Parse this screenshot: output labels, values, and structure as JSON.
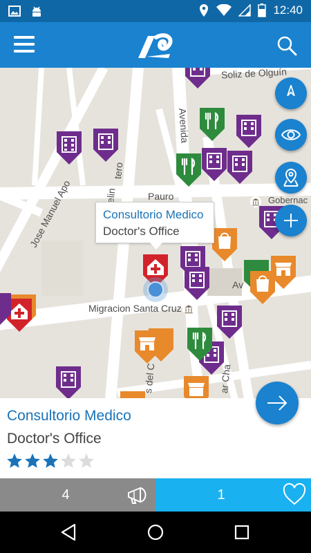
{
  "status_bar": {
    "time": "12:40",
    "left_icons": [
      "image-icon",
      "android-icon"
    ],
    "right_icons": [
      "location-icon",
      "wifi-icon",
      "signal-icon",
      "battery-icon"
    ]
  },
  "app_bar": {
    "menu_icon": "hamburger-icon",
    "logo": "app-logo",
    "search_icon": "search-icon"
  },
  "map": {
    "streets": [
      "Soliz de Olguín",
      "Avenida",
      "Jose Manuel Apo",
      "Marcelin",
      "tero",
      "Pauro",
      "Migracion Santa Cruz",
      "Gobernac",
      "Av",
      "s del C",
      "ar Cha"
    ],
    "buttons": [
      "compass-icon",
      "eye-icon",
      "map-pin-icon",
      "plus-icon"
    ]
  },
  "callout": {
    "title": "Consultorio Medico",
    "subtitle": "Doctor's Office"
  },
  "detail": {
    "title": "Consultorio Medico",
    "subtitle": "Doctor's Office",
    "rating": 3,
    "rating_max": 5
  },
  "actions": {
    "left_count": "4",
    "left_icon": "megaphone-icon",
    "right_count": "1",
    "right_icon": "heart-icon"
  },
  "colors": {
    "primary": "#1a82cf",
    "status": "#0f67a6",
    "building": "#6e2d8c",
    "restaurant": "#2e8b3d",
    "shop": "#e8892c",
    "medical": "#d2232a",
    "favorite": "#1ab1f0"
  },
  "nav": [
    "back-icon",
    "home-icon",
    "recents-icon"
  ]
}
